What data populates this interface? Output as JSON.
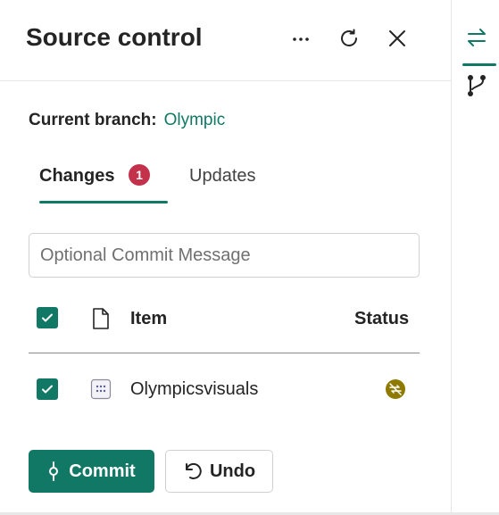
{
  "header": {
    "title": "Source control",
    "icons": [
      "more-icon",
      "refresh-icon",
      "close-icon"
    ]
  },
  "branch": {
    "label": "Current branch:",
    "name": "Olympic"
  },
  "tabs": [
    {
      "label": "Changes",
      "badge": "1",
      "active": true
    },
    {
      "label": "Updates",
      "active": false
    }
  ],
  "commit_message": {
    "placeholder": "Optional Commit Message",
    "value": ""
  },
  "table": {
    "columns": [
      "Item",
      "Status"
    ],
    "select_all_checked": true,
    "rows": [
      {
        "name": "Olympicsvisuals",
        "checked": true,
        "icon": "report-icon",
        "status_icon": "not-synced-status-icon"
      }
    ]
  },
  "buttons": {
    "commit": "Commit",
    "undo": "Undo"
  },
  "rail": {
    "items": [
      "source-control-icon",
      "branch-icon"
    ],
    "active": "source-control-icon"
  },
  "colors": {
    "accent": "#117865",
    "badge": "#c4314b",
    "status": "#8f7a00"
  }
}
